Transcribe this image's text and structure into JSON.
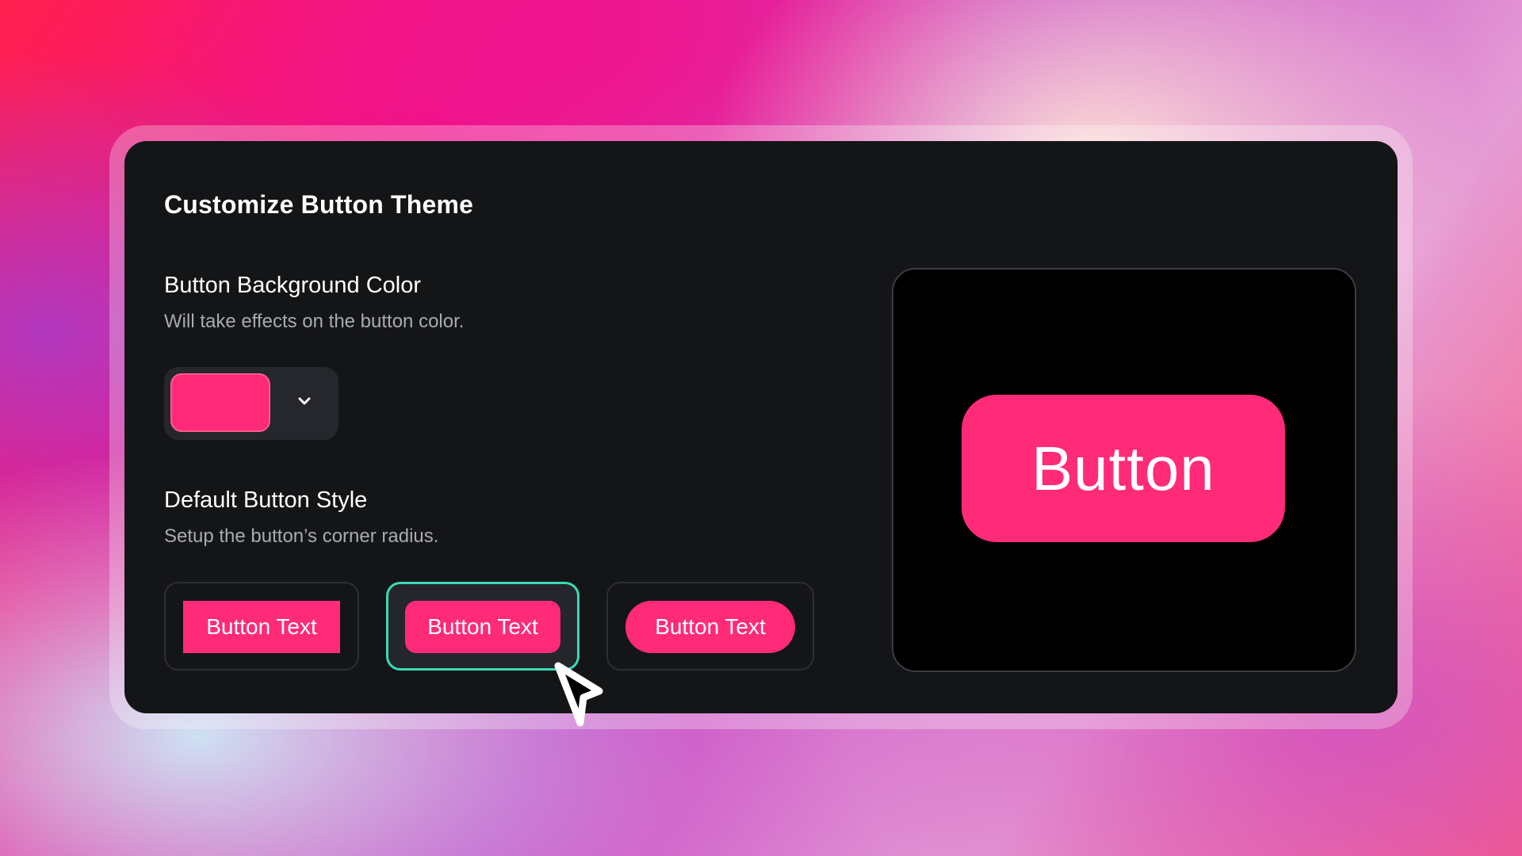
{
  "theme": {
    "accent": "#ff2a78",
    "selection": "#3ad9b6",
    "card_bg": "#141517"
  },
  "panel": {
    "title": "Customize Button Theme"
  },
  "background_color": {
    "label": "Button Background Color",
    "description": "Will take effects on the button color.",
    "selected_color": "#ff2a78",
    "dropdown_icon": "chevron-down-icon"
  },
  "button_style": {
    "label": "Default Button Style",
    "description": "Setup the button’s corner radius.",
    "options": [
      {
        "label": "Button Text",
        "corner": "square",
        "selected": false
      },
      {
        "label": "Button Text",
        "corner": "rounded",
        "selected": true
      },
      {
        "label": "Button Text",
        "corner": "pill",
        "selected": false
      }
    ]
  },
  "preview": {
    "button_label": "Button"
  },
  "cursor": {
    "icon": "mouse-pointer-icon"
  }
}
